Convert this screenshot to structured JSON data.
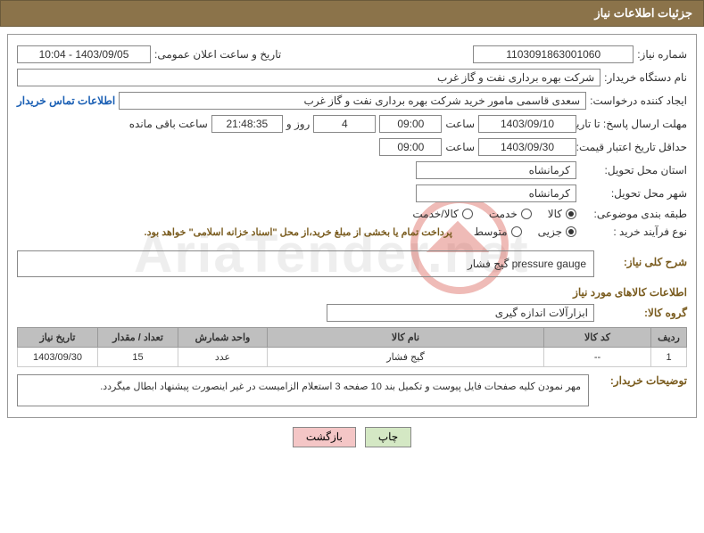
{
  "header": {
    "title": "جزئیات اطلاعات نیاز"
  },
  "fields": {
    "need_no_label": "شماره نیاز:",
    "need_no": "1103091863001060",
    "announce_label": "تاریخ و ساعت اعلان عمومی:",
    "announce_value": "1403/09/05 - 10:04",
    "buyer_org_label": "نام دستگاه خریدار:",
    "buyer_org": "شرکت بهره برداری نفت و گاز غرب",
    "requester_label": "ایجاد کننده درخواست:",
    "requester": "سعدی قاسمی مامور خرید شرکت بهره برداری نفت و گاز غرب",
    "contact_link": "اطلاعات تماس خریدار",
    "deadline_label": "مهلت ارسال پاسخ: تا تاریخ:",
    "deadline_date": "1403/09/10",
    "time_word": "ساعت",
    "deadline_time": "09:00",
    "days_count": "4",
    "days_and": "روز و",
    "countdown": "21:48:35",
    "remain_label": "ساعت باقی مانده",
    "validity_label": "حداقل تاریخ اعتبار قیمت: تا تاریخ:",
    "validity_date": "1403/09/30",
    "validity_time": "09:00",
    "province_label": "استان محل تحویل:",
    "province": "کرمانشاه",
    "city_label": "شهر محل تحویل:",
    "city": "کرمانشاه",
    "category_label": "طبقه بندی موضوعی:",
    "cat_goods": "کالا",
    "cat_service": "خدمت",
    "cat_both": "کالا/خدمت",
    "process_label": "نوع فرآیند خرید :",
    "proc_partial": "جزیی",
    "proc_medium": "متوسط",
    "treasury_note": "پرداخت تمام یا بخشی از مبلغ خرید،از محل \"اسناد خزانه اسلامی\" خواهد بود.",
    "desc_label": "شرح کلی نیاز:",
    "desc_value": "pressure gauge  گیج فشار",
    "goods_section": "اطلاعات کالاهای مورد نیاز",
    "goods_group_label": "گروه کالا:",
    "goods_group": "ابزارآلات اندازه گیری",
    "buyer_notes_label": "توضیحات خریدار:",
    "buyer_notes": "مهر نمودن کلیه صفحات فایل پیوست و تکمیل بند 10 صفحه 3 استعلام الزامیست در غیر اینصورت پیشنهاد ابطال میگردد."
  },
  "table": {
    "headers": {
      "row": "ردیف",
      "code": "کد کالا",
      "name": "نام کالا",
      "unit": "واحد شمارش",
      "qty": "تعداد / مقدار",
      "date": "تاریخ نیاز"
    },
    "rows": [
      {
        "row": "1",
        "code": "--",
        "name": "گیج فشار",
        "unit": "عدد",
        "qty": "15",
        "date": "1403/09/30"
      }
    ]
  },
  "buttons": {
    "print": "چاپ",
    "back": "بازگشت"
  },
  "watermark": "AriaTender.net"
}
